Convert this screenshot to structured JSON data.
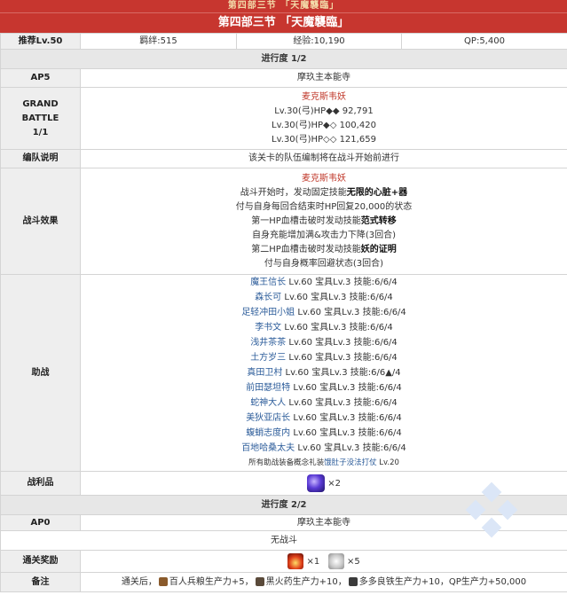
{
  "header": {
    "top_title": "第四部三节 「天魔襲臨」",
    "main_title": "第四部三节 「天魔襲臨」"
  },
  "info_row": {
    "recommend": "推荐Lv.50",
    "bond": "羁绊:515",
    "exp": "经验:10,190",
    "qp": "QP:5,400"
  },
  "progress1": "进行度 1/2",
  "ap1": {
    "label": "AP5",
    "value": "摩玖主本能寺"
  },
  "grand_battle": {
    "label_line1": "GRAND",
    "label_line2": "BATTLE",
    "label_line3": "1/1",
    "enemy_name": "麦克斯韦妖",
    "enemies": [
      "Lv.30(弓)HP◆◆ 92,791",
      "Lv.30(弓)HP◆◇ 100,420",
      "Lv.30(弓)HP◇◇ 121,659"
    ]
  },
  "formation": {
    "label": "编队说明",
    "text": "该关卡的队伍编制将在战斗开始前进行"
  },
  "battle_effect": {
    "label": "战斗效果",
    "name": "麦克斯韦妖",
    "line1a": "战斗开始时，发动固定技能",
    "line1b": "无限的心脏+器",
    "line2": "付与自身每回合结束时HP回复20,000的状态",
    "line3a": "第一HP血槽击破时发动技能",
    "line3b": "范式转移",
    "line4": "自身充能增加满&攻击力下降(3回合)",
    "line5a": "第二HP血槽击破时发动技能",
    "line5b": "妖的证明",
    "line6": "付与自身概率回避状态(3回合)"
  },
  "support": {
    "label": "助战",
    "rows": [
      {
        "name": "魔王信长",
        "stats": " Lv.60 宝具Lv.3 技能:6/6/4"
      },
      {
        "name": "森长可",
        "stats": " Lv.60 宝具Lv.3 技能:6/6/4"
      },
      {
        "name": "足轻冲田小姐",
        "stats": " Lv.60 宝具Lv.3 技能:6/6/4"
      },
      {
        "name": "李书文",
        "stats": " Lv.60 宝具Lv.3 技能:6/6/4"
      },
      {
        "name": "浅井茶茶",
        "stats": " Lv.60 宝具Lv.3 技能:6/6/4"
      },
      {
        "name": "土方岁三",
        "stats": " Lv.60 宝具Lv.3 技能:6/6/4"
      },
      {
        "name": "真田卫村",
        "stats": " Lv.60 宝具Lv.3 技能:6/6▲/4"
      },
      {
        "name": "前田瑟坦特",
        "stats": " Lv.60 宝具Lv.3 技能:6/6/4"
      },
      {
        "name": "蛇神大人",
        "stats": " Lv.60 宝具Lv.3 技能:6/6/4"
      },
      {
        "name": "美狄亚店长",
        "stats": " Lv.60 宝具Lv.3 技能:6/6/4"
      },
      {
        "name": "蝮蛸志度内",
        "stats": " Lv.60 宝具Lv.3 技能:6/6/4"
      },
      {
        "name": "百地哈桑太夫",
        "stats": " Lv.60 宝具Lv.3 技能:6/6/4"
      }
    ],
    "footer_a": "所有助战装备概念礼装",
    "footer_link": "饿肚子没法打仗",
    "footer_b": " Lv.20"
  },
  "loot": {
    "label": "战利品",
    "count": "×2"
  },
  "progress2": "进行度 2/2",
  "ap2": {
    "label": "AP0",
    "value": "摩玖主本能寺"
  },
  "no_battle": "无战斗",
  "clear_reward": {
    "label": "通关奖励",
    "item1_count": "×1",
    "item2_count": "×5"
  },
  "notes": {
    "label": "备注",
    "prefix": "通关后，",
    "p1": "百人兵粮生产力+5，",
    "p2": "黑火药生产力+10，",
    "p3": "多多良铁生产力+10，QP生产力+50,000"
  }
}
